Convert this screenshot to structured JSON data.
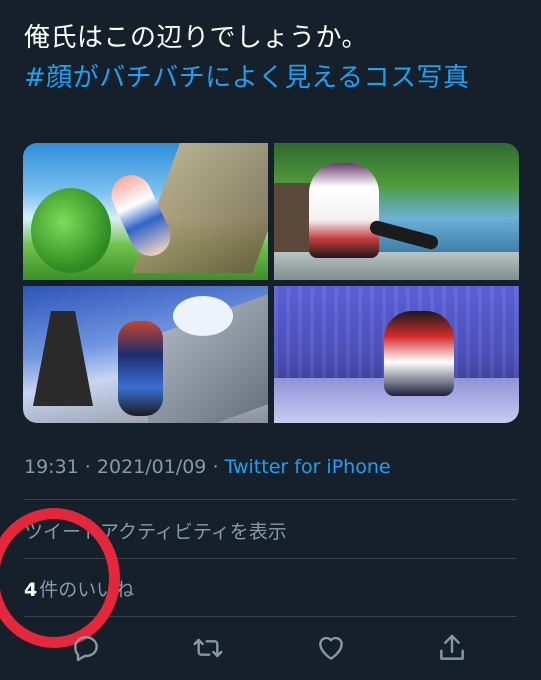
{
  "tweet": {
    "text_line1": "俺氏はこの辺りでしょうか。",
    "hashtag": "#顔がバチバチによく見えるコス写真"
  },
  "meta": {
    "time": "19:31",
    "separator": " · ",
    "date": "2021/01/09",
    "source": "Twitter for iPhone"
  },
  "activity": {
    "label": "ツイートアクティビティを表示"
  },
  "likes": {
    "count": "4",
    "label": "件のいいね"
  },
  "actions": {
    "reply_icon": "reply-icon",
    "retweet_icon": "retweet-icon",
    "like_icon": "heart-icon",
    "share_icon": "share-icon"
  },
  "colors": {
    "background": "#15202b",
    "accent": "#1da1f2",
    "annotation_circle": "#e6263a"
  }
}
